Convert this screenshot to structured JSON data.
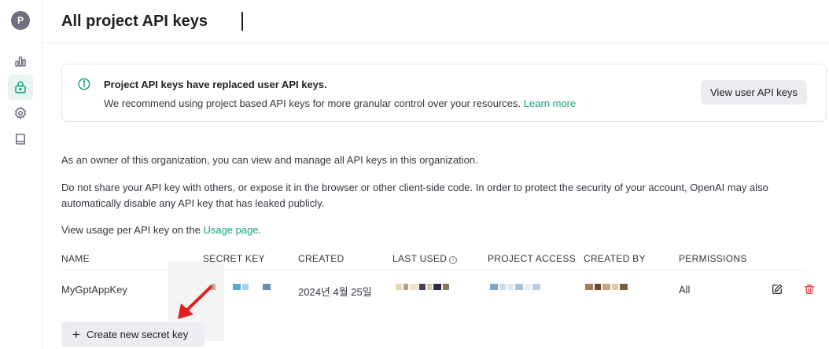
{
  "sidebar": {
    "avatar_letter": "P",
    "items": [
      {
        "icon": "bar-chart-icon",
        "active": false
      },
      {
        "icon": "lock-icon",
        "active": true
      },
      {
        "icon": "gear-icon",
        "active": false
      },
      {
        "icon": "book-icon",
        "active": false
      }
    ]
  },
  "header": {
    "title": "All project API keys"
  },
  "notice": {
    "title": "Project API keys have replaced user API keys.",
    "body": "We recommend using project based API keys for more granular control over your resources.",
    "learn_more": "Learn more",
    "button": "View user API keys"
  },
  "paragraphs": {
    "p1": "As an owner of this organization, you can view and manage all API keys in this organization.",
    "p2": "Do not share your API key with others, or expose it in the browser or other client-side code. In order to protect the security of your account, OpenAI may also automatically disable any API key that has leaked publicly.",
    "p3_prefix": "View usage per API key on the",
    "p3_link": "Usage page",
    "p3_suffix": "."
  },
  "table": {
    "headers": {
      "name": "NAME",
      "secret_key": "SECRET KEY",
      "created": "CREATED",
      "last_used": "LAST USED",
      "project_access": "PROJECT ACCESS",
      "created_by": "CREATED BY",
      "permissions": "PERMISSIONS"
    },
    "rows": [
      {
        "name": "MyGptAppKey",
        "created": "2024년 4월 25일",
        "permissions": "All"
      }
    ]
  },
  "create_button": "Create new secret key",
  "colors": {
    "accent": "#10a37f",
    "danger": "#e5484d",
    "annotation_arrow": "#e02020"
  }
}
